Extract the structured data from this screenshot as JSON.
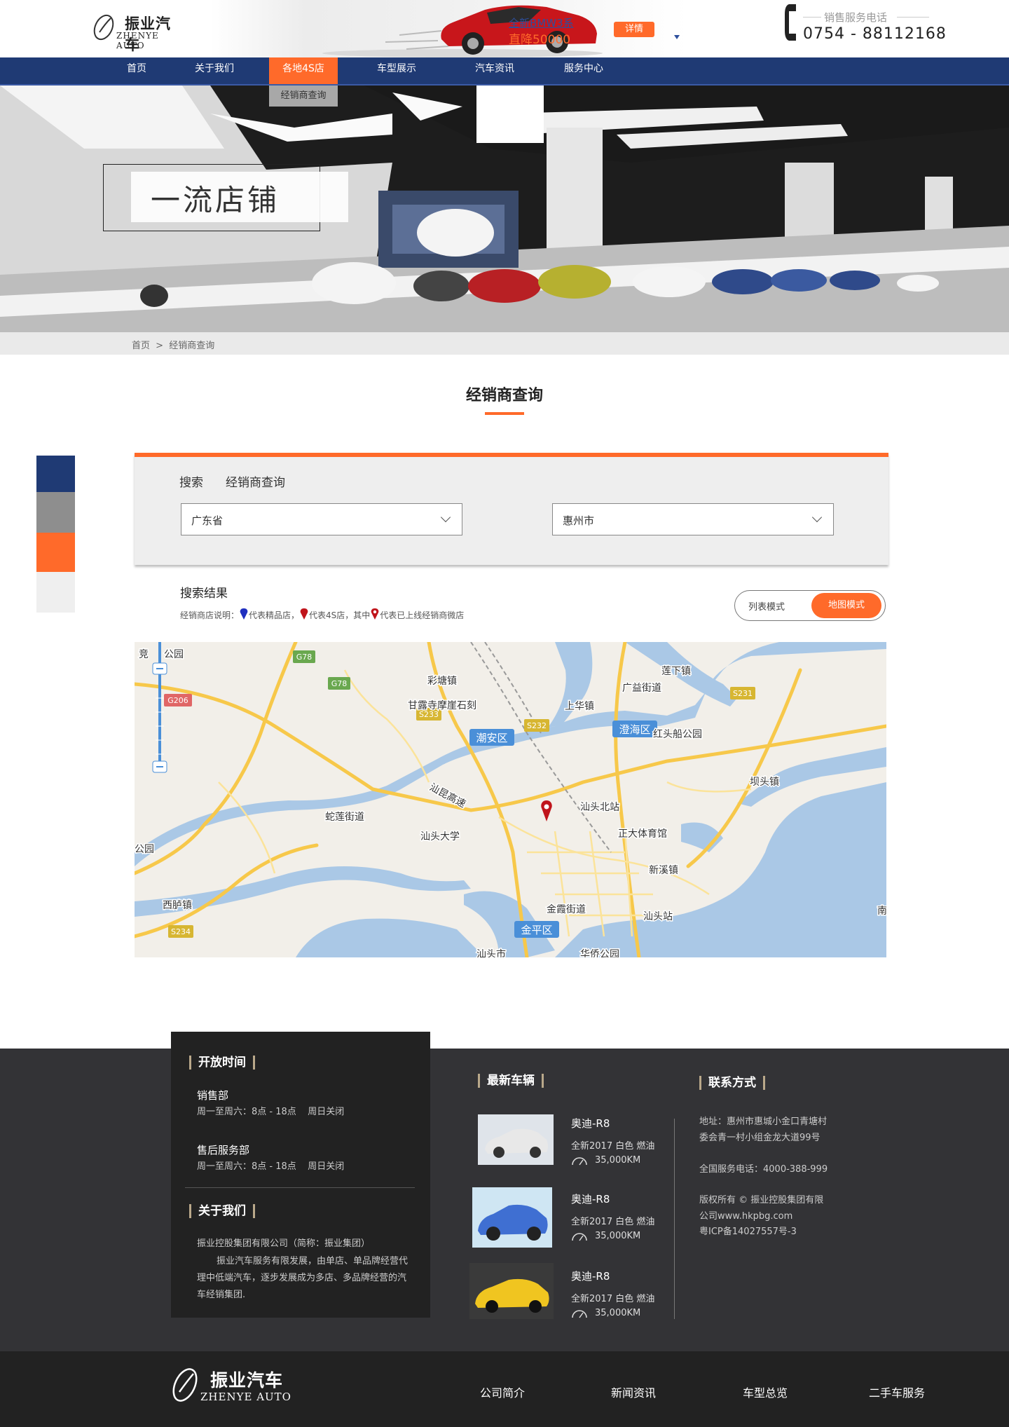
{
  "brand": {
    "name_cn": "振业汽车",
    "name_en": "ZHENYE AUTO"
  },
  "promo": {
    "line1": "全新BMW3系",
    "line2": "直降50000",
    "detail_label": "详情"
  },
  "hotline": {
    "label": "销售服务电话",
    "number": "0754 - 88112168"
  },
  "nav": {
    "items": [
      {
        "label": "首页"
      },
      {
        "label": "关于我们"
      },
      {
        "label": "各地4S店"
      },
      {
        "label": "车型展示"
      },
      {
        "label": "汽车资讯"
      },
      {
        "label": "服务中心"
      }
    ],
    "active_index": 2,
    "submenu_label": "经销商查询"
  },
  "banner": {
    "title": "一流店铺"
  },
  "breadcrumb": {
    "home": "首页",
    "sep": ">",
    "current": "经销商查询"
  },
  "page_title": "经销商查询",
  "search": {
    "label": "搜索",
    "sub_label": "经销商查询",
    "province": "广东省",
    "city": "惠州市"
  },
  "results": {
    "title": "搜索结果",
    "desc_prefix": "经销商店说明：",
    "desc_blue": "代表精品店，",
    "desc_red": "代表4S店，其中",
    "desc_red2": "代表已上线经销商微店",
    "list_mode": "列表模式",
    "map_mode": "地图模式"
  },
  "map": {
    "labels": [
      "竞",
      "公园",
      "彩塘镇",
      "甘露寺摩崖石刻",
      "上华镇",
      "广益街道",
      "莲下镇",
      "潮安区",
      "澄海区",
      "红头船公园",
      "坝头镇",
      "汕昆高速",
      "汕头北站",
      "蛇莲街道",
      "汕头大学",
      "正大体育馆",
      "新溪镇",
      "公园",
      "西胪镇",
      "金霞街道",
      "汕头站",
      "金平区",
      "汕头市",
      "华侨公园",
      "南"
    ],
    "roads": [
      "G78",
      "G78",
      "G206",
      "S233",
      "S232",
      "S231",
      "S234"
    ]
  },
  "footer": {
    "hours_title": "开放时间",
    "sales_dept": "销售部",
    "sales_hours": "周一至周六：8点 - 18点    周日关闭",
    "service_dept": "售后服务部",
    "service_hours": "周一至周六：8点 - 18点    周日关闭",
    "about_title": "关于我们",
    "about_company": "振业控股集团有限公司（简称：振业集团）",
    "about_text": "振业汽车服务有限发展，由单店、单品牌经营代理中低端汽车，逐步发展成为多店、多品牌经营的汽车经销集团.",
    "new_cars_title": "最新车辆",
    "cars": [
      {
        "name": "奥迪-R8",
        "spec": "全新2017 白色 燃油",
        "km": "35,000KM",
        "color": "#e8e8e8"
      },
      {
        "name": "奥迪-R8",
        "spec": "全新2017 白色 燃油",
        "km": "35,000KM",
        "color": "#3f6fd2"
      },
      {
        "name": "奥迪-R8",
        "spec": "全新2017 白色 燃油",
        "km": "35,000KM",
        "color": "#f0c520"
      }
    ],
    "contact_title": "联系方式",
    "address_line1": "地址：惠州市惠城小金口青塘村",
    "address_line2": "委会青一村小组金龙大道99号",
    "service_phone": "全国服务电话：4000-388-999",
    "copyright_line1": "版权所有 © 振业控股集团有限",
    "copyright_line2": "公司www.hkpbg.com",
    "icp": "粤ICP备14027557号-3"
  },
  "bottom_links": [
    "公司简介",
    "新闻资讯",
    "车型总览",
    "二手车服务"
  ],
  "colors": {
    "nav": "#1f3a74",
    "accent": "#ff6a2a",
    "footer": "#333336",
    "footer_dark": "#222222"
  }
}
